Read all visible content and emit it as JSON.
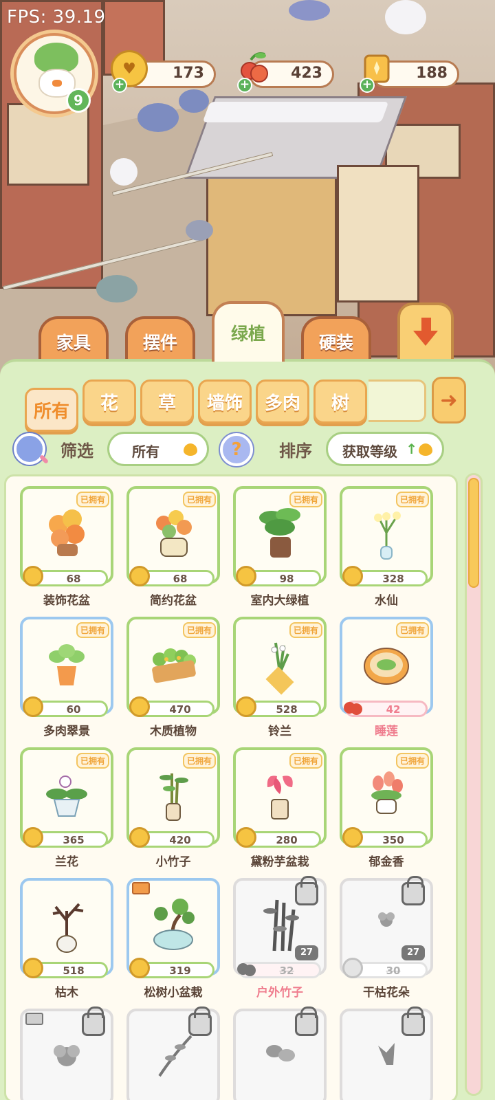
{
  "fps": "FPS: 39.19",
  "player": {
    "level": "9"
  },
  "resources": [
    {
      "name": "coins",
      "icon": "coin-icon",
      "value": "173"
    },
    {
      "name": "berries",
      "icon": "berry-icon",
      "value": "423"
    },
    {
      "name": "tickets",
      "icon": "ticket-icon",
      "value": "188"
    }
  ],
  "category_tabs": [
    "家具",
    "摆件",
    "绿植",
    "硬装"
  ],
  "active_category": "绿植",
  "sub_tabs": [
    "所有",
    "花",
    "草",
    "墙饰",
    "多肉",
    "树"
  ],
  "active_sub_tab": "所有",
  "filter": {
    "label": "筛选",
    "value": "所有"
  },
  "sort": {
    "label": "排序",
    "value": "获取等级"
  },
  "owned_label": "已拥有",
  "items": [
    {
      "name": "装饰花盆",
      "price": "68",
      "currency": "coin",
      "status": "owned",
      "frame": "green"
    },
    {
      "name": "简约花盆",
      "price": "68",
      "currency": "coin",
      "status": "owned",
      "frame": "green"
    },
    {
      "name": "室内大绿植",
      "price": "98",
      "currency": "coin",
      "status": "owned",
      "frame": "green"
    },
    {
      "name": "水仙",
      "price": "328",
      "currency": "coin",
      "status": "owned",
      "frame": "green"
    },
    {
      "name": "多肉翠景",
      "price": "60",
      "currency": "coin",
      "status": "owned",
      "frame": "blue"
    },
    {
      "name": "木质植物",
      "price": "470",
      "currency": "coin",
      "status": "owned",
      "frame": "green"
    },
    {
      "name": "铃兰",
      "price": "528",
      "currency": "coin",
      "status": "owned",
      "frame": "green"
    },
    {
      "name": "睡莲",
      "price": "42",
      "currency": "berry",
      "status": "owned",
      "frame": "blue"
    },
    {
      "name": "兰花",
      "price": "365",
      "currency": "coin",
      "status": "owned",
      "frame": "green"
    },
    {
      "name": "小竹子",
      "price": "420",
      "currency": "coin",
      "status": "owned",
      "frame": "green"
    },
    {
      "name": "黛粉芋盆栽",
      "price": "280",
      "currency": "coin",
      "status": "owned",
      "frame": "green"
    },
    {
      "name": "郁金香",
      "price": "350",
      "currency": "coin",
      "status": "owned",
      "frame": "green"
    },
    {
      "name": "枯木",
      "price": "518",
      "currency": "coin",
      "status": "available",
      "frame": "blue"
    },
    {
      "name": "松树小盆栽",
      "price": "319",
      "currency": "coin",
      "status": "available",
      "frame": "blue"
    },
    {
      "name": "户外竹子",
      "price": "32",
      "currency": "berry",
      "status": "locked",
      "unlock_level": "27",
      "frame": "grey"
    },
    {
      "name": "干枯花朵",
      "price": "30",
      "currency": "coin",
      "status": "locked",
      "unlock_level": "27",
      "frame": "grey"
    }
  ],
  "colors": {
    "panel_bg": "#dcefc3",
    "tab_orange": "#f2a25a",
    "accent_green": "#7aa84c",
    "owned_orange": "#f0a53a",
    "berry_pink": "#ef7d8e"
  }
}
